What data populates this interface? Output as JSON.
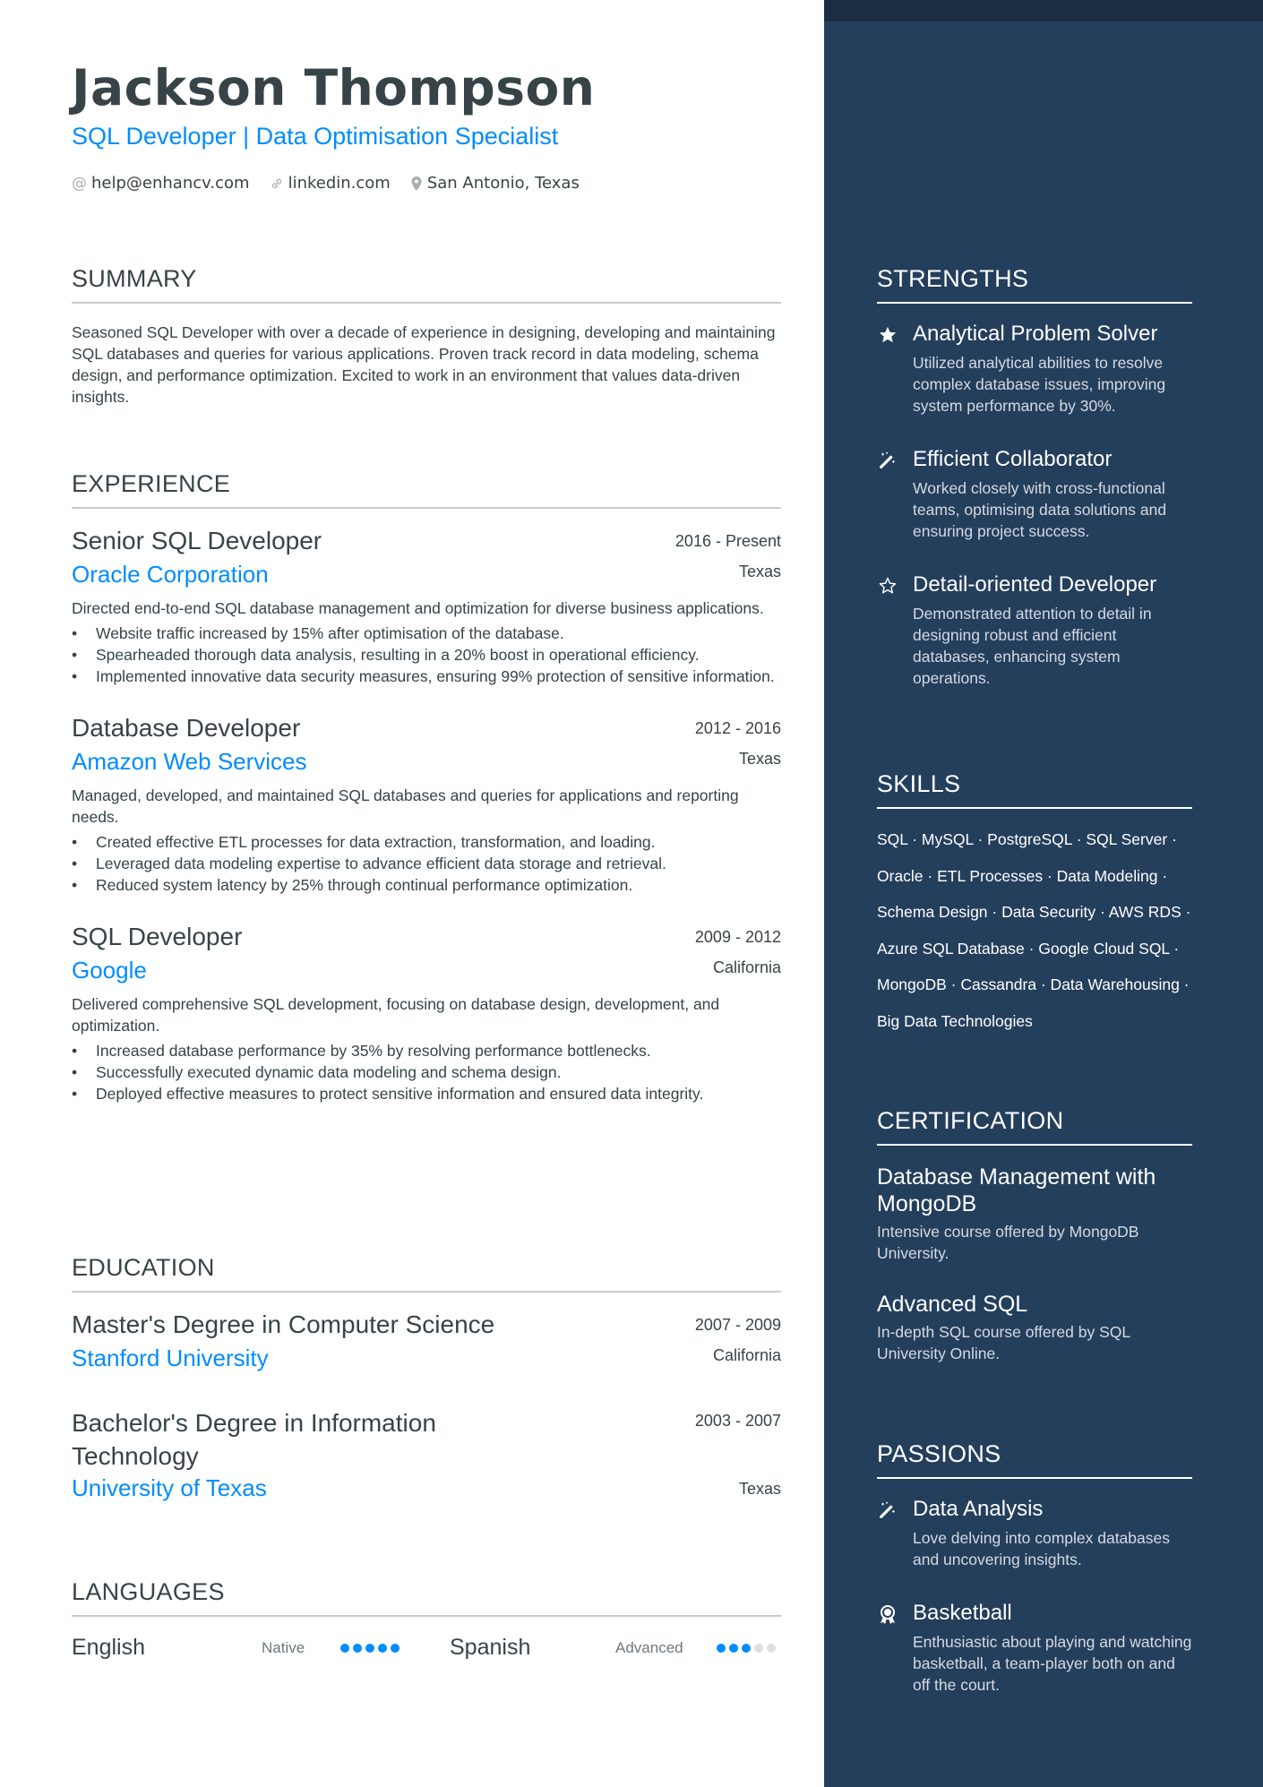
{
  "header": {
    "name": "Jackson Thompson",
    "headline": "SQL Developer | Data Optimisation Specialist",
    "contacts": [
      {
        "icon": "at-icon",
        "text": "help@enhancv.com"
      },
      {
        "icon": "link-icon",
        "text": "linkedin.com"
      },
      {
        "icon": "location-pin-icon",
        "text": "San Antonio, Texas"
      }
    ]
  },
  "colors": {
    "accent": "#008cff",
    "text": "#384347",
    "sidebar_bg": "#243f5c",
    "sidebar_top": "#1b2d43"
  },
  "summary": {
    "title": "Summary",
    "text": "Seasoned SQL Developer with over a decade of experience in designing, developing and maintaining SQL databases and queries for various applications. Proven track record in data modeling, schema design, and performance optimization. Excited to work in an environment that values data-driven insights."
  },
  "experience": {
    "title": "Experience",
    "items": [
      {
        "role": "Senior SQL Developer",
        "dates": "2016 - Present",
        "company": "Oracle Corporation",
        "location": "Texas",
        "description": "Directed end-to-end SQL database management and optimization for diverse business applications.",
        "bullets": [
          "Website traffic increased by 15% after optimisation of the database.",
          "Spearheaded thorough data analysis, resulting in a 20% boost in operational efficiency.",
          "Implemented innovative data security measures, ensuring 99% protection of sensitive information."
        ]
      },
      {
        "role": "Database Developer",
        "dates": "2012 - 2016",
        "company": "Amazon Web Services",
        "location": "Texas",
        "description": "Managed, developed, and maintained SQL databases and queries for applications and reporting needs.",
        "bullets": [
          "Created effective ETL processes for data extraction, transformation, and loading.",
          "Leveraged data modeling expertise to advance efficient data storage and retrieval.",
          "Reduced system latency by 25% through continual performance optimization."
        ]
      },
      {
        "role": "SQL Developer",
        "dates": "2009 - 2012",
        "company": "Google",
        "location": "California",
        "description": "Delivered comprehensive SQL development, focusing on database design, development, and optimization.",
        "bullets": [
          "Increased database performance by 35% by resolving performance bottlenecks.",
          "Successfully executed dynamic data modeling and schema design.",
          "Deployed effective measures to protect sensitive information and ensured data integrity."
        ]
      }
    ]
  },
  "education": {
    "title": "Education",
    "items": [
      {
        "degree": "Master's Degree in Computer Science",
        "dates": "2007 - 2009",
        "school": "Stanford University",
        "location": "California"
      },
      {
        "degree": "Bachelor's Degree in Information Technology",
        "dates": "2003 - 2007",
        "school": "University of Texas",
        "location": "Texas"
      }
    ]
  },
  "languages": {
    "title": "Languages",
    "items": [
      {
        "name": "English",
        "level": "Native",
        "rating": 5,
        "max": 5
      },
      {
        "name": "Spanish",
        "level": "Advanced",
        "rating": 3,
        "max": 5
      }
    ]
  },
  "strengths": {
    "title": "Strengths",
    "items": [
      {
        "icon": "star-filled-icon",
        "title": "Analytical Problem Solver",
        "description": "Utilized analytical abilities to resolve complex database issues, improving system performance by 30%."
      },
      {
        "icon": "magic-wand-icon",
        "title": "Efficient Collaborator",
        "description": "Worked closely with cross-functional teams, optimising data solutions and ensuring project success."
      },
      {
        "icon": "star-outline-icon",
        "title": "Detail-oriented Developer",
        "description": "Demonstrated attention to detail in designing robust and efficient databases, enhancing system operations."
      }
    ]
  },
  "skills": {
    "title": "Skills",
    "lines": [
      "SQL · MySQL · PostgreSQL · SQL Server ·",
      "Oracle · ETL Processes · Data Modeling ·",
      "Schema Design · Data Security · AWS RDS ·",
      "Azure SQL Database · Google Cloud SQL ·",
      "MongoDB · Cassandra · Data Warehousing ·",
      "Big Data Technologies"
    ]
  },
  "certification": {
    "title": "Certification",
    "items": [
      {
        "title": "Database Management with MongoDB",
        "description": "Intensive course offered by MongoDB University."
      },
      {
        "title": "Advanced SQL",
        "description": "In-depth SQL course offered by SQL University Online."
      }
    ]
  },
  "passions": {
    "title": "Passions",
    "items": [
      {
        "icon": "magic-wand-icon",
        "title": "Data Analysis",
        "description": "Love delving into complex databases and uncovering insights."
      },
      {
        "icon": "award-ribbon-icon",
        "title": "Basketball",
        "description": "Enthusiastic about playing and watching basketball, a team-player both on and off the court."
      }
    ]
  }
}
